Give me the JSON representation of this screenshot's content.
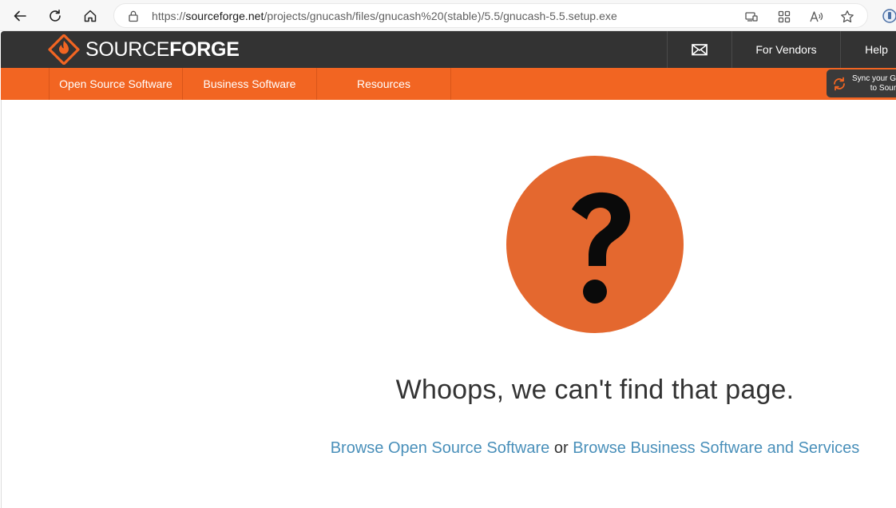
{
  "browser": {
    "url_prefix": "https://",
    "url_domain": "sourceforge.net",
    "url_path": "/projects/gnucash/files/gnucash%20(stable)/5.5/gnucash-5.5.setup.exe",
    "icons": [
      "back-icon",
      "refresh-icon",
      "home-icon",
      "lock-icon",
      "app-available-icon",
      "apps-icon",
      "read-aloud-icon",
      "favorite-star-icon",
      "extension-icon"
    ]
  },
  "header": {
    "logo_light": "SOURCE",
    "logo_bold": "FORGE",
    "for_vendors": "For Vendors",
    "help": "Help"
  },
  "nav": {
    "items": [
      {
        "label": "Open Source Software"
      },
      {
        "label": "Business Software"
      },
      {
        "label": "Resources"
      }
    ],
    "sync_line1": "Sync your Git",
    "sync_line2": "to Sourc"
  },
  "main": {
    "headline": "Whoops, we can't find that page.",
    "link1": "Browse Open Source Software",
    "or_text": "or",
    "link2": "Browse Business Software and Services"
  },
  "colors": {
    "brand_orange": "#f26522",
    "header_dark": "#333333",
    "link_blue": "#4a90ba",
    "circle_orange": "#e4682f"
  }
}
